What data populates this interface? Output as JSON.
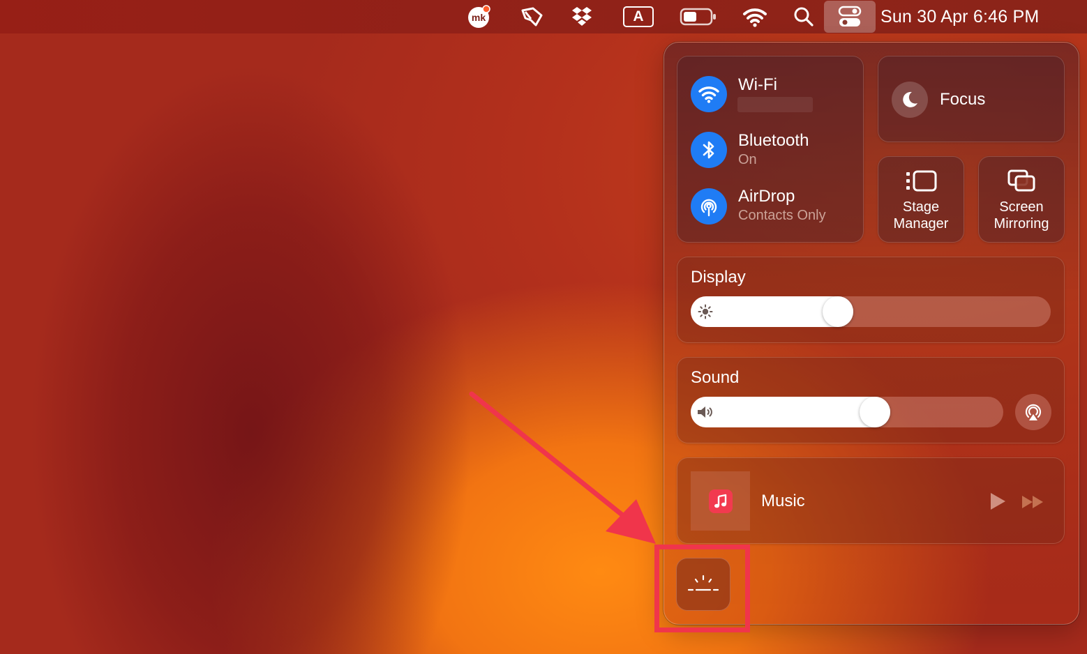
{
  "menubar": {
    "clock": "Sun 30 Apr  6:46 PM",
    "icons": [
      "mk-app-icon",
      "flag-icon",
      "dropbox-icon",
      "input-source-icon",
      "battery-icon",
      "wifi-icon",
      "spotlight-search-icon",
      "control-center-icon"
    ],
    "input_source": "A"
  },
  "control_center": {
    "wifi": {
      "title": "Wi-Fi",
      "subtitle": "",
      "state": "on"
    },
    "bluetooth": {
      "title": "Bluetooth",
      "subtitle": "On"
    },
    "airdrop": {
      "title": "AirDrop",
      "subtitle": "Contacts Only"
    },
    "focus": {
      "title": "Focus"
    },
    "stage_manager": {
      "line1": "Stage",
      "line2": "Manager"
    },
    "screen_mirroring": {
      "line1": "Screen",
      "line2": "Mirroring"
    },
    "display": {
      "title": "Display",
      "brightness_fraction": 0.4
    },
    "sound": {
      "title": "Sound",
      "volume_fraction": 0.6
    },
    "now_playing": {
      "app": "Music"
    },
    "extra_button": {
      "icon": "keyboard-brightness-icon"
    }
  },
  "colors": {
    "accent_blue": "#1f7cf5",
    "annotation_red": "#f0354b",
    "music_red": "#f23a4f"
  }
}
